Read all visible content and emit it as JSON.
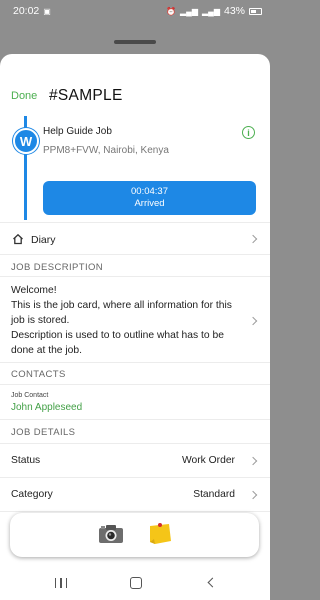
{
  "status_bar": {
    "time": "20:02",
    "battery": "43%",
    "icons": [
      "image-icon",
      "alarm-icon",
      "signal-icon",
      "wifi-icon",
      "battery-icon"
    ]
  },
  "sheet": {
    "done_label": "Done",
    "title": "#SAMPLE"
  },
  "job": {
    "avatar_letter": "W",
    "name": "Help Guide Job",
    "address": "PPM8+FVW, Nairobi, Kenya",
    "timer": {
      "elapsed": "00:04:37",
      "status": "Arrived"
    }
  },
  "diary": {
    "label": "Diary"
  },
  "job_description": {
    "section_title": "JOB DESCRIPTION",
    "text": "Welcome!\nThis is the job card, where all information for this job is stored.\nDescription is used to to outline what has to be done at the job."
  },
  "contacts": {
    "section_title": "CONTACTS",
    "contact_label": "Job Contact",
    "contact_name": "John Appleseed"
  },
  "job_details": {
    "section_title": "JOB DETAILS",
    "rows": [
      {
        "label": "Status",
        "value": "Work Order"
      },
      {
        "label": "Category",
        "value": "Standard"
      }
    ]
  },
  "colors": {
    "accent_blue": "#1e88e5",
    "accent_green": "#4caf50",
    "contact_green": "#43a047",
    "note_yellow": "#f5c518"
  }
}
